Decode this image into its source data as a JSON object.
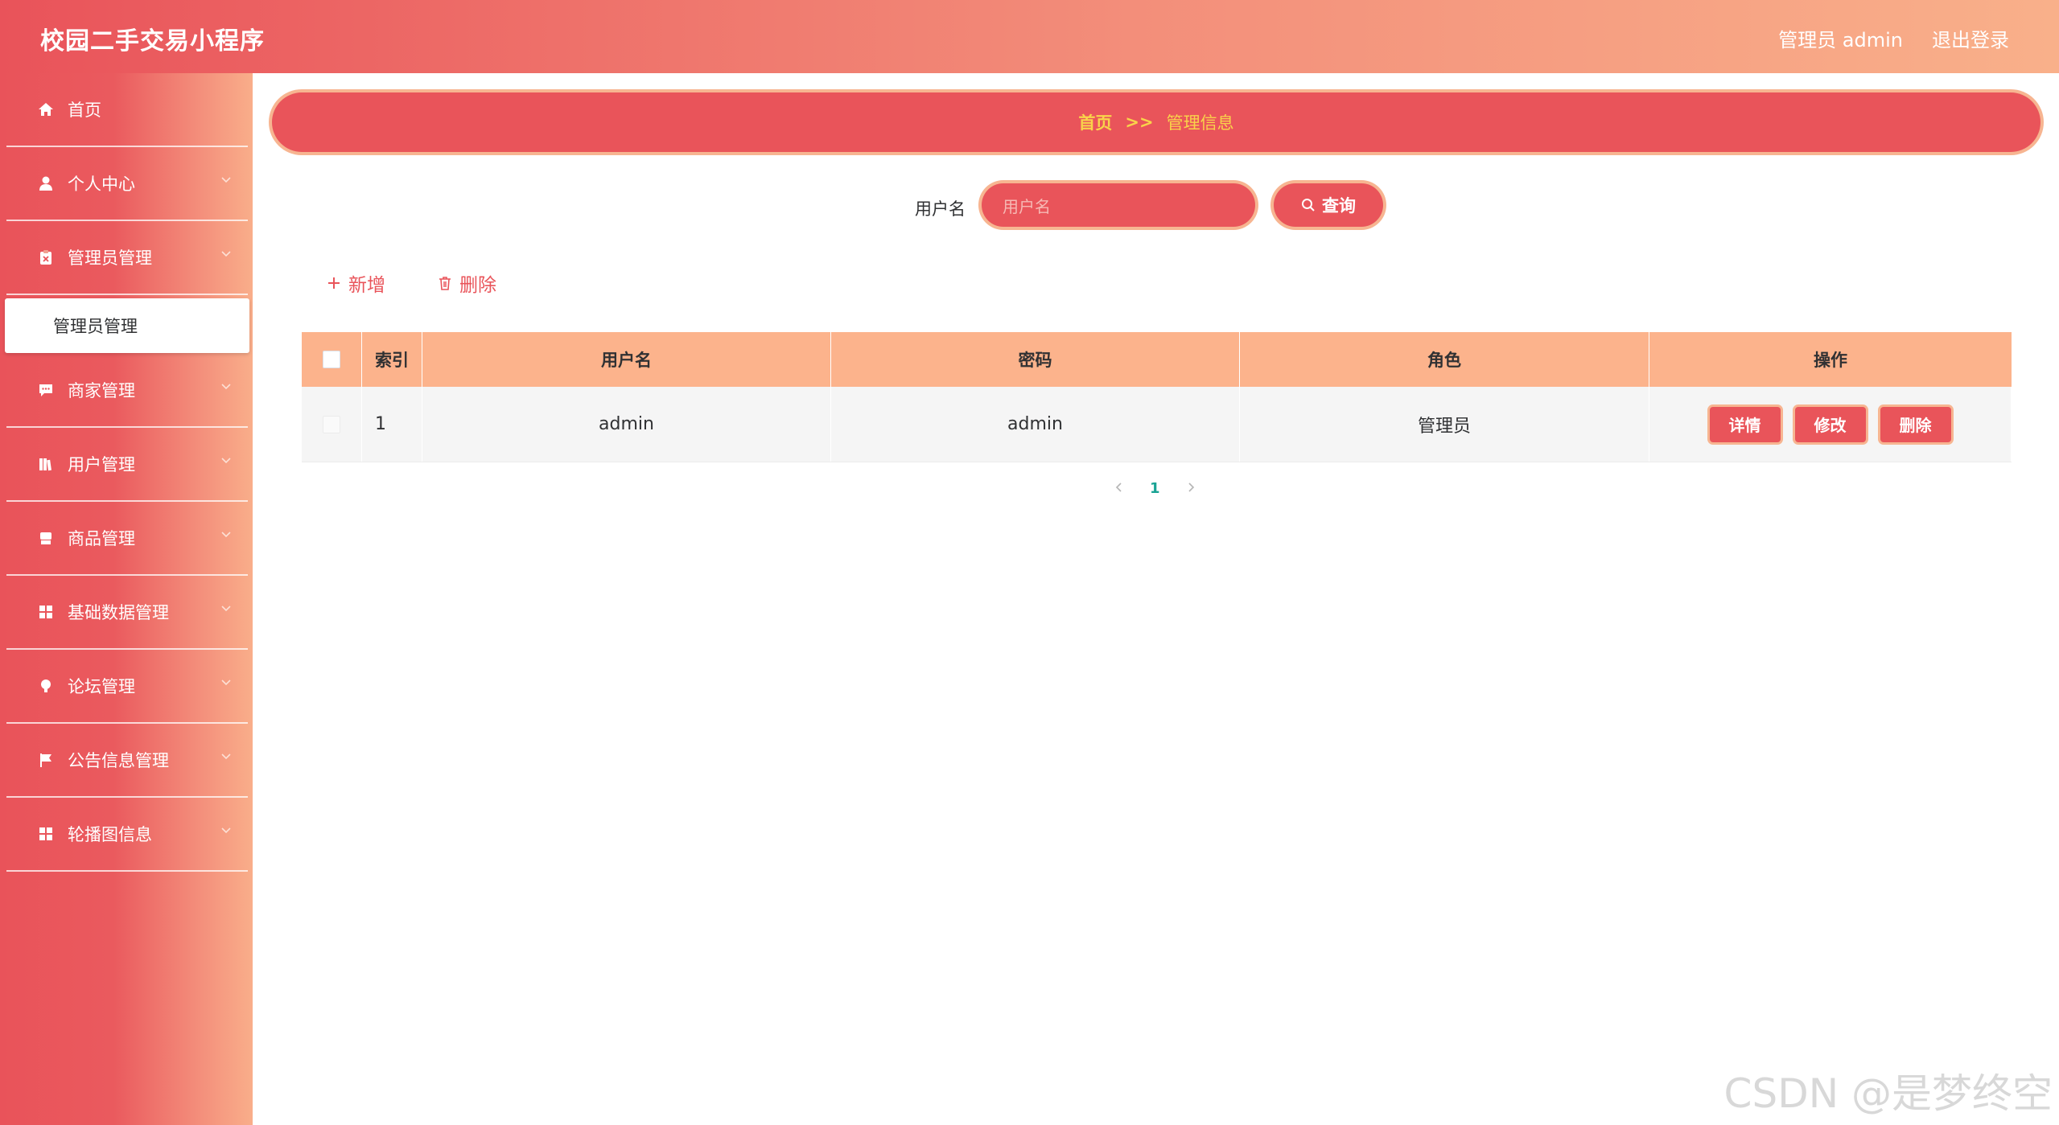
{
  "app": {
    "title": "校园二手交易小程序"
  },
  "header": {
    "user_label": "管理员 admin",
    "logout_label": "退出登录"
  },
  "sidebar": {
    "items": [
      {
        "label": "首页",
        "icon": "home-icon"
      },
      {
        "label": "个人中心",
        "icon": "user-icon"
      },
      {
        "label": "管理员管理",
        "icon": "clipboard-icon"
      },
      {
        "label": "商家管理",
        "icon": "chat-icon"
      },
      {
        "label": "用户管理",
        "icon": "book-icon"
      },
      {
        "label": "商品管理",
        "icon": "shop-icon"
      },
      {
        "label": "基础数据管理",
        "icon": "grid-icon"
      },
      {
        "label": "论坛管理",
        "icon": "bulb-icon"
      },
      {
        "label": "公告信息管理",
        "icon": "flag-icon"
      },
      {
        "label": "轮播图信息",
        "icon": "grid-icon"
      }
    ],
    "submenu_label": "管理员管理"
  },
  "breadcrumb": {
    "home": "首页",
    "separator": ">>",
    "current": "管理信息"
  },
  "search": {
    "label": "用户名",
    "placeholder": "用户名",
    "button_label": "查询"
  },
  "actions": {
    "add_label": "新增",
    "delete_label": "删除"
  },
  "table": {
    "columns": [
      "索引",
      "用户名",
      "密码",
      "角色",
      "操作"
    ],
    "rows": [
      {
        "index": "1",
        "username": "admin",
        "password": "admin",
        "role": "管理员"
      }
    ],
    "row_actions": {
      "detail": "详情",
      "edit": "修改",
      "delete": "删除"
    }
  },
  "pagination": {
    "current_page": "1"
  },
  "watermark": "CSDN @是梦终空",
  "colors": {
    "primary": "#e9545a",
    "accent": "#f7b591",
    "header_bg": "#fcb38c",
    "breadcrumb_text": "#f9d34a",
    "page_active": "#1aa394"
  }
}
